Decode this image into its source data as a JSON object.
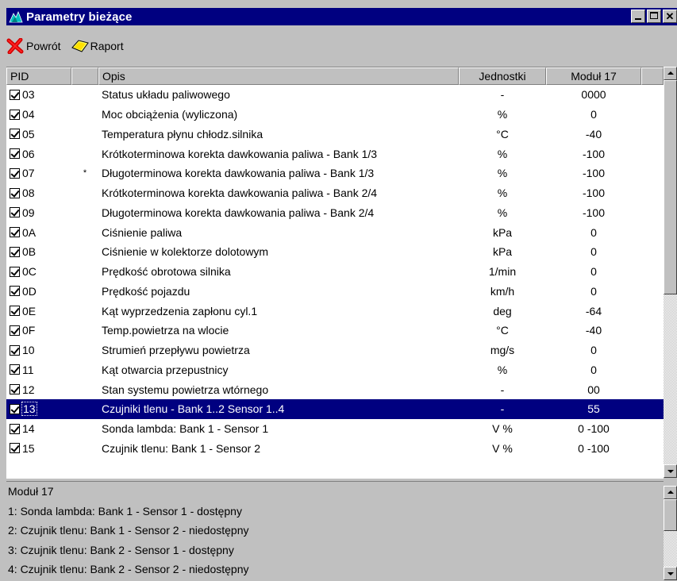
{
  "window": {
    "title": "Parametry bieżące",
    "title_color": "#000080",
    "icon": "app-logo-icon"
  },
  "toolbar": {
    "back_label": "Powrót",
    "back_icon": "red-x-icon",
    "report_label": "Raport",
    "report_icon": "yellow-tag-icon"
  },
  "table": {
    "columns": [
      "PID",
      "",
      "Opis",
      "Jednostki",
      "Moduł 17"
    ],
    "rows": [
      {
        "pid": "03",
        "star": "",
        "desc": "Status układu paliwowego",
        "unit": "-",
        "value": "0000",
        "checked": true
      },
      {
        "pid": "04",
        "star": "",
        "desc": "Moc obciążenia (wyliczona)",
        "unit": "%",
        "value": "0",
        "checked": true
      },
      {
        "pid": "05",
        "star": "",
        "desc": "Temperatura płynu chłodz.silnika",
        "unit": "°C",
        "value": "-40",
        "checked": true
      },
      {
        "pid": "06",
        "star": "",
        "desc": "Krótkoterminowa korekta dawkowania paliwa - Bank 1/3",
        "unit": "%",
        "value": "-100",
        "checked": true
      },
      {
        "pid": "07",
        "star": "*",
        "desc": "Długoterminowa korekta dawkowania paliwa - Bank 1/3",
        "unit": "%",
        "value": "-100",
        "checked": true
      },
      {
        "pid": "08",
        "star": "",
        "desc": "Krótkoterminowa korekta dawkowania paliwa - Bank 2/4",
        "unit": "%",
        "value": "-100",
        "checked": true
      },
      {
        "pid": "09",
        "star": "",
        "desc": "Długoterminowa korekta dawkowania paliwa - Bank 2/4",
        "unit": "%",
        "value": "-100",
        "checked": true
      },
      {
        "pid": "0A",
        "star": "",
        "desc": "Ciśnienie paliwa",
        "unit": "kPa",
        "value": "0",
        "checked": true
      },
      {
        "pid": "0B",
        "star": "",
        "desc": "Ciśnienie w kolektorze dolotowym",
        "unit": "kPa",
        "value": "0",
        "checked": true
      },
      {
        "pid": "0C",
        "star": "",
        "desc": "Prędkość obrotowa silnika",
        "unit": "1/min",
        "value": "0",
        "checked": true
      },
      {
        "pid": "0D",
        "star": "",
        "desc": "Prędkość pojazdu",
        "unit": "km/h",
        "value": "0",
        "checked": true
      },
      {
        "pid": "0E",
        "star": "",
        "desc": "Kąt wyprzedzenia zapłonu cyl.1",
        "unit": "deg",
        "value": "-64",
        "checked": true
      },
      {
        "pid": "0F",
        "star": "",
        "desc": "Temp.powietrza na wlocie",
        "unit": "°C",
        "value": "-40",
        "checked": true
      },
      {
        "pid": "10",
        "star": "",
        "desc": "Strumień przepływu powietrza",
        "unit": "mg/s",
        "value": "0",
        "checked": true
      },
      {
        "pid": "11",
        "star": "",
        "desc": "Kąt otwarcia przepustnicy",
        "unit": "%",
        "value": "0",
        "checked": true
      },
      {
        "pid": "12",
        "star": "",
        "desc": "Stan systemu powietrza wtórnego",
        "unit": "-",
        "value": "00",
        "checked": true
      },
      {
        "pid": "13",
        "star": "",
        "desc": "Czujniki tlenu - Bank 1..2 Sensor 1..4",
        "unit": "-",
        "value": "55",
        "checked": true,
        "selected": true
      },
      {
        "pid": "14",
        "star": "",
        "desc": "Sonda lambda: Bank 1 - Sensor 1",
        "unit": "V  %",
        "value": "0  -100",
        "checked": true
      },
      {
        "pid": "15",
        "star": "",
        "desc": "Czujnik tlenu: Bank 1 - Sensor 2",
        "unit": "V  %",
        "value": "0  -100",
        "checked": true
      }
    ],
    "selected_color": "#000080"
  },
  "info": {
    "lines": [
      "Moduł 17",
      "1: Sonda lambda: Bank 1 - Sensor 1 - dostępny",
      "2: Czujnik tlenu: Bank 1 - Sensor 2 - niedostępny",
      "3: Czujnik tlenu: Bank 2 - Sensor 1 - dostępny",
      "4: Czujnik tlenu: Bank 2 - Sensor 2 - niedostępny"
    ]
  }
}
